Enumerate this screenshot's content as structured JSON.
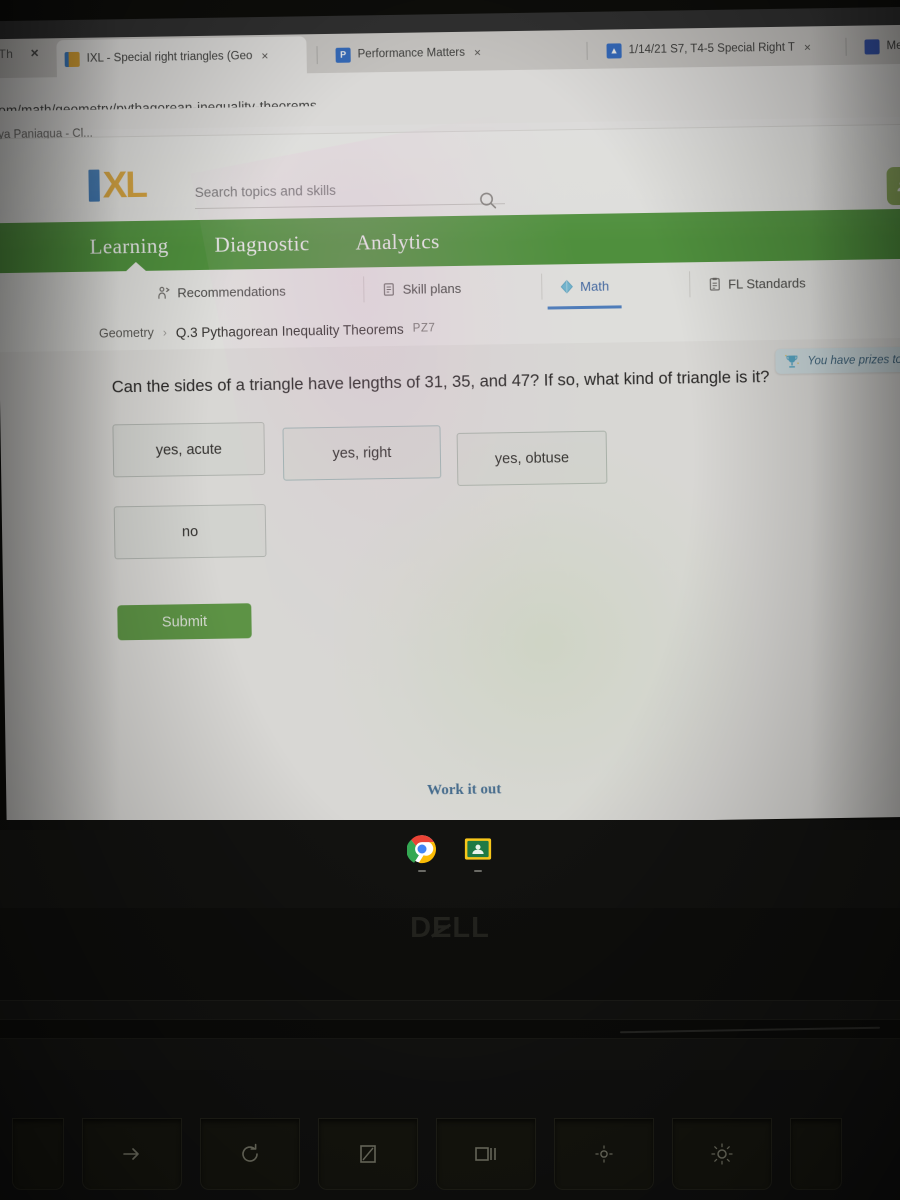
{
  "browser": {
    "partial_left_tab_label": "Th",
    "tabs": [
      {
        "label": "IXL - Special right triangles (Geo",
        "favicon": "ixl-favicon",
        "active": true,
        "close_label": "×"
      },
      {
        "label": "Performance Matters",
        "favicon": "performance-matters-favicon",
        "active": false,
        "close_label": "×"
      },
      {
        "label": "1/14/21 S7, T4-5 Special Right T",
        "favicon": "drive-favicon",
        "active": false,
        "close_label": "×"
      },
      {
        "label": "Mee",
        "favicon": "meet-favicon",
        "active": false,
        "close_label": "×"
      }
    ],
    "url": "com/math/geometry/pythagorean-inequality-theorems",
    "bookmark": "aya Paniagua - Cl..."
  },
  "ixl": {
    "logo_text": "XL",
    "search": {
      "placeholder": "Search topics and skills",
      "value": ""
    },
    "main_nav": [
      {
        "label": "Learning",
        "active": true
      },
      {
        "label": "Diagnostic",
        "active": false
      },
      {
        "label": "Analytics",
        "active": false
      }
    ],
    "sub_nav": [
      {
        "label": "Recommendations",
        "icon": "recommendations-icon",
        "active": false
      },
      {
        "label": "Skill plans",
        "icon": "skill-plans-icon",
        "active": false
      },
      {
        "label": "Math",
        "icon": "math-diamond-icon",
        "active": true
      },
      {
        "label": "FL Standards",
        "icon": "standards-icon",
        "active": false
      }
    ],
    "breadcrumb": {
      "subject": "Geometry",
      "separator": "›",
      "skill": "Q.3 Pythagorean Inequality Theorems",
      "skill_code": "PZ7"
    },
    "prize_banner": {
      "text": "You have prizes to re",
      "icon": "trophy-icon"
    },
    "question": {
      "text": "Can the sides of a triangle have lengths of 31, 35, and 47? If so, what kind of triangle is it?",
      "choices": [
        {
          "label": "yes, acute"
        },
        {
          "label": "yes, right"
        },
        {
          "label": "yes, obtuse"
        },
        {
          "label": "no"
        }
      ],
      "submit_label": "Submit",
      "work_it_out_label": "Work it out"
    },
    "colors": {
      "nav_green": "#4a9e32",
      "submit_green": "#5ba23c",
      "logo_blue": "#2d79c7",
      "logo_yellow": "#f0ab1f",
      "active_tab_blue": "#4a86d6"
    }
  },
  "shelf": {
    "icons": [
      {
        "name": "chrome-icon",
        "label": "Chrome"
      },
      {
        "name": "google-classroom-icon",
        "label": "Classroom"
      }
    ]
  },
  "laptop": {
    "brand": "DELL",
    "brand_part_1": "D",
    "brand_part_2": "E",
    "brand_part_3": "LL",
    "function_keys": [
      {
        "icon": "forward-arrow-key",
        "label": "forward"
      },
      {
        "icon": "reload-key",
        "label": "reload"
      },
      {
        "icon": "fullscreen-key",
        "label": "fullscreen"
      },
      {
        "icon": "window-overview-key",
        "label": "overview"
      },
      {
        "icon": "brightness-down-key",
        "label": "brightness down"
      },
      {
        "icon": "brightness-up-key",
        "label": "brightness up"
      }
    ]
  }
}
